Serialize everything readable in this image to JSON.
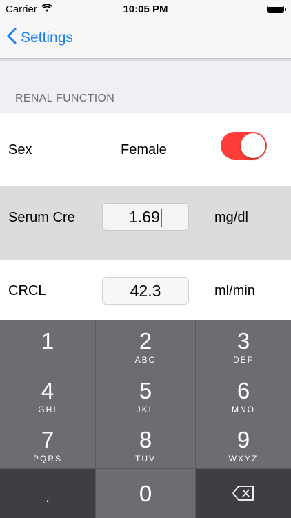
{
  "status_bar": {
    "carrier": "Carrier",
    "time": "10:05 PM"
  },
  "nav": {
    "back_label": "Settings"
  },
  "section": {
    "header": "RENAL FUNCTION"
  },
  "rows": {
    "sex": {
      "label": "Sex",
      "value": "Female",
      "toggle_on": true
    },
    "serum": {
      "label": "Serum Cre",
      "value": "1.69",
      "unit": "mg/dl"
    },
    "crcl": {
      "label": "CRCL",
      "value": "42.3",
      "unit": "ml/min"
    }
  },
  "keyboard": {
    "keys": [
      {
        "num": "1",
        "letters": ""
      },
      {
        "num": "2",
        "letters": "ABC"
      },
      {
        "num": "3",
        "letters": "DEF"
      },
      {
        "num": "4",
        "letters": "GHI"
      },
      {
        "num": "5",
        "letters": "JKL"
      },
      {
        "num": "6",
        "letters": "MNO"
      },
      {
        "num": "7",
        "letters": "PQRS"
      },
      {
        "num": "8",
        "letters": "TUV"
      },
      {
        "num": "9",
        "letters": "WXYZ"
      },
      {
        "num": ".",
        "letters": ""
      },
      {
        "num": "0",
        "letters": ""
      },
      {
        "num": "⌫",
        "letters": ""
      }
    ]
  },
  "colors": {
    "accent": "#147efb",
    "toggle_on": "#fc3d39",
    "keyboard_bg": "#585a5d"
  }
}
